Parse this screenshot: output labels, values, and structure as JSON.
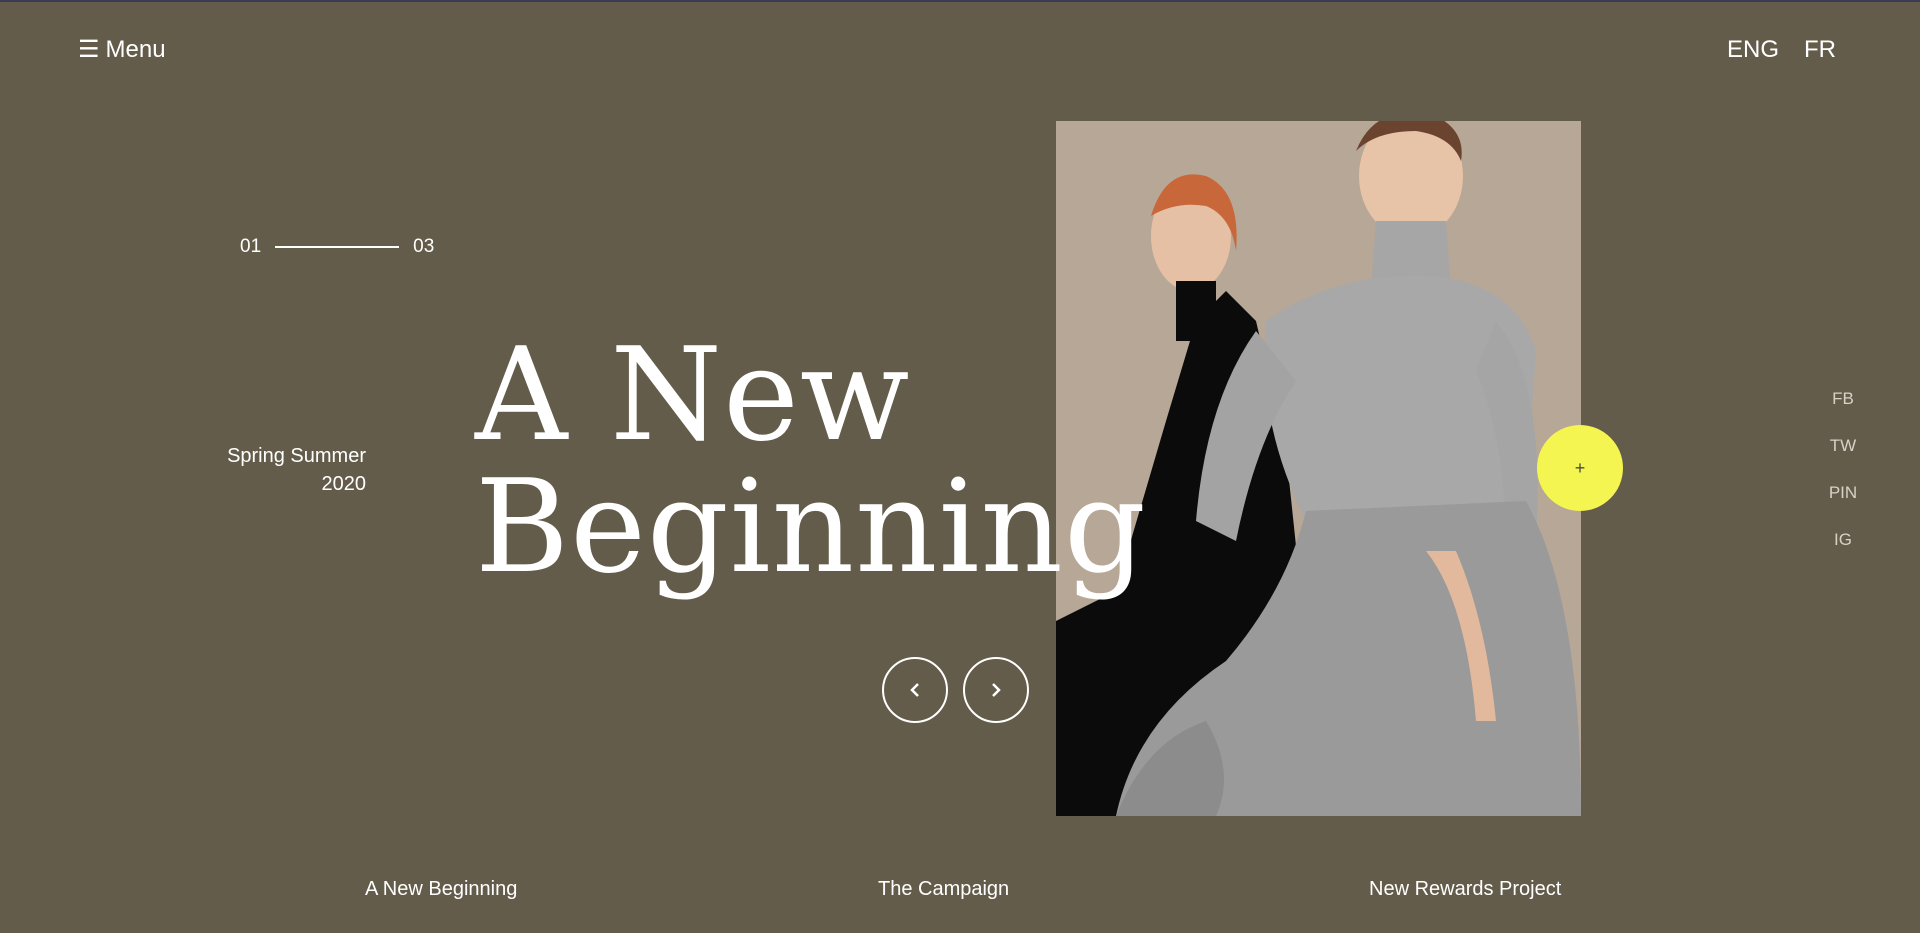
{
  "header": {
    "menu_icon": "☰",
    "menu_label": "Menu",
    "languages": [
      "ENG",
      "FR"
    ]
  },
  "slider": {
    "current": "01",
    "total": "03"
  },
  "hero": {
    "season_line1": "Spring Summer",
    "season_line2": "2020",
    "title_line1": "A New",
    "title_line2": "Beginning",
    "plus_label": "+"
  },
  "social": [
    "FB",
    "TW",
    "PIN",
    "IG"
  ],
  "bottom_nav": [
    "A New Beginning",
    "The Campaign",
    "New Rewards Project"
  ],
  "colors": {
    "background": "#645c4a",
    "accent": "#f5f552",
    "text": "#ffffff"
  },
  "icons": {
    "prev": "chevron-left-icon",
    "next": "chevron-right-icon",
    "menu": "hamburger-icon"
  }
}
